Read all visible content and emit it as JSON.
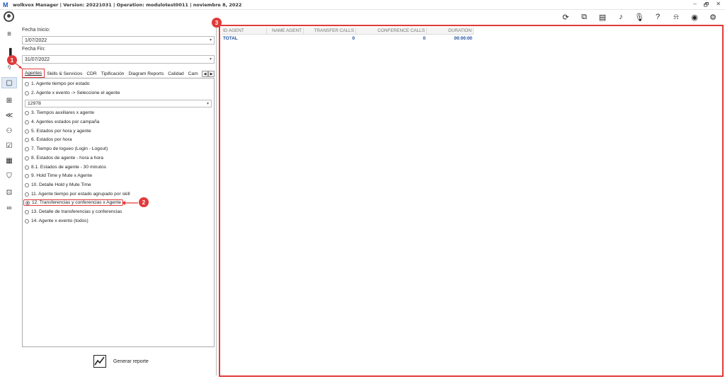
{
  "titlebar": {
    "logo": "M",
    "title": "wolkvox Manager  | Version: 20221031 |  Operation: modulotest0011  |  noviembre 8, 2022",
    "controls": [
      "–",
      "🗗",
      "✕"
    ]
  },
  "toolbar_icons": [
    "refresh-icon",
    "library-icon",
    "contact-card-icon",
    "music-note-icon",
    "microphone-icon",
    "help-icon",
    "bell-icon",
    "user-circle-icon",
    "settings-icon"
  ],
  "sidebar": {
    "items": [
      {
        "name": "menu-icon",
        "glyph": "≡"
      },
      {
        "name": "bar-chart-icon",
        "glyph": "▐"
      },
      {
        "name": "analytics-icon",
        "glyph": "ᵑ"
      },
      {
        "name": "reports-icon",
        "glyph": "▢"
      },
      {
        "name": "hierarchy-icon",
        "glyph": "⊞"
      },
      {
        "name": "campaign-icon",
        "glyph": "≪"
      },
      {
        "name": "users-group-icon",
        "glyph": "⚇"
      },
      {
        "name": "checklist-icon",
        "glyph": "☑"
      },
      {
        "name": "calculator-icon",
        "glyph": "▦"
      },
      {
        "name": "shield-icon",
        "glyph": "⛉"
      },
      {
        "name": "video-add-icon",
        "glyph": "⊡"
      },
      {
        "name": "voicemail-icon",
        "glyph": "∞"
      }
    ]
  },
  "filters": {
    "start_label": "Fecha Inicio:",
    "start_value": "1/07/2022",
    "end_label": "Fecha Fin:",
    "end_value": "31/07/2022"
  },
  "tabs": [
    "Agentes",
    "Skills & Servicios",
    "CDR",
    "Tipificación",
    "Diagram Reports",
    "Calidad",
    "Cam"
  ],
  "reports": [
    {
      "label": "1. Agente tiempo por estado"
    },
    {
      "label": "2. Agente x evento -> Seleccione el agente"
    },
    {
      "label": "3. Tiempos auxiliares x agente"
    },
    {
      "label": "4. Agentes estados por campaña"
    },
    {
      "label": "5. Estados por hora y agente"
    },
    {
      "label": "6. Estados por hora"
    },
    {
      "label": "7. Tiempo de logueo (Login - Logout)"
    },
    {
      "label": "8. Estados de agente - hora a hora"
    },
    {
      "label": "8.1. Estados de agente - 30 minutos"
    },
    {
      "label": "9. Hold Time y Mute x Agente"
    },
    {
      "label": "10. Detalle Hold y Mute Time"
    },
    {
      "label": "11. Agente tiempo por estado agrupado por skill"
    },
    {
      "label": "12. Transferencias y conferencias x Agente"
    },
    {
      "label": "13. Detalle de transferencias y conferencias"
    },
    {
      "label": "14. Agente x evento (todos)"
    }
  ],
  "agent_select": "12978",
  "generate_button": "Generar reporte",
  "badges": [
    "1",
    "2",
    "3"
  ],
  "results": {
    "columns": [
      "ID AGENT",
      "NAME AGENT",
      "TRANSFER CALLS",
      "CONFERENCE CALLS",
      "DURATION"
    ],
    "total_row": [
      "TOTAL",
      "",
      "0",
      "0",
      "00:00:00"
    ]
  }
}
